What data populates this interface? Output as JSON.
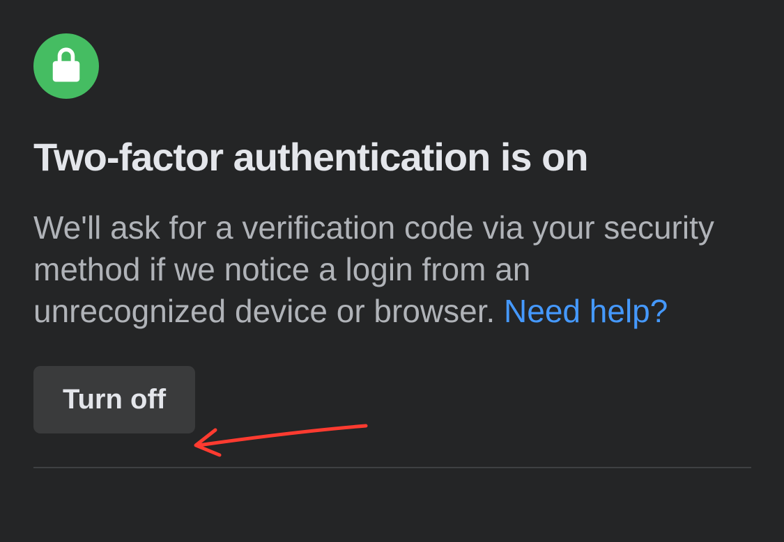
{
  "security": {
    "icon": "lock-icon",
    "title": "Two-factor authentication is on",
    "description_text": "We'll ask for a verification code via your security method if we notice a login from an unrecognized device or browser. ",
    "help_link_label": "Need help?",
    "turn_off_label": "Turn off"
  },
  "annotation": {
    "type": "arrow",
    "color": "#ff3b30",
    "points_to": "turn-off-button"
  },
  "colors": {
    "background": "#242526",
    "accent_green": "#45bd62",
    "link_blue": "#4599ff",
    "annotation_red": "#ff3b30",
    "button_bg": "#3a3b3c"
  }
}
